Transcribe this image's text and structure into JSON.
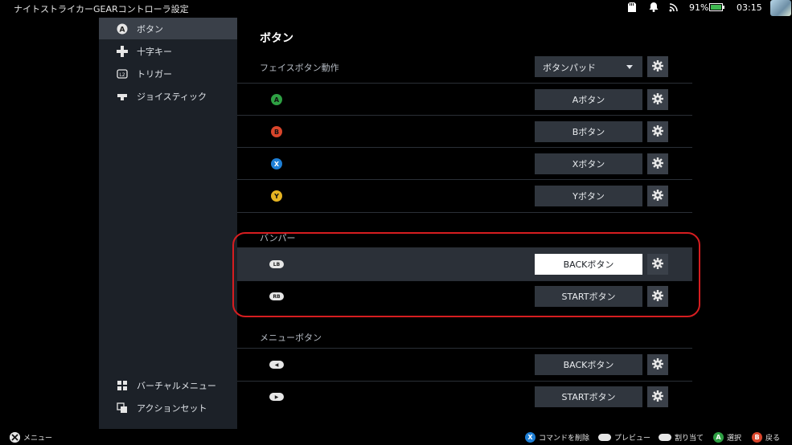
{
  "window": {
    "title": "ナイトストライカーGEARコントローラ設定"
  },
  "status_bar": {
    "battery": "91%",
    "time": "03:15"
  },
  "sidebar": {
    "items": [
      {
        "label": "ボタン",
        "icon": "a-button-icon"
      },
      {
        "label": "十字キー",
        "icon": "dpad-icon"
      },
      {
        "label": "トリガー",
        "icon": "l2-trigger-icon"
      },
      {
        "label": "ジョイスティック",
        "icon": "joystick-icon"
      }
    ],
    "bottom_items": [
      {
        "label": "バーチャルメニュー",
        "icon": "grid-icon"
      },
      {
        "label": "アクションセット",
        "icon": "layers-icon"
      }
    ]
  },
  "main": {
    "title": "ボタン",
    "face_buttons": {
      "label": "フェイスボタン動作",
      "mode": "ボタンパッド",
      "rows": [
        {
          "button": "A",
          "color": "#2ea043",
          "binding": "Aボタン"
        },
        {
          "button": "B",
          "color": "#d9452b",
          "binding": "Bボタン"
        },
        {
          "button": "X",
          "color": "#1e7fd6",
          "binding": "Xボタン"
        },
        {
          "button": "Y",
          "color": "#e6b422",
          "binding": "Yボタン"
        }
      ]
    },
    "bumpers": {
      "label": "バンパー",
      "rows": [
        {
          "button": "LB",
          "binding": "BACKボタン"
        },
        {
          "button": "RB",
          "binding": "STARTボタン"
        }
      ]
    },
    "menu_buttons": {
      "label": "メニューボタン",
      "rows": [
        {
          "button": "◀",
          "binding": "BACKボタン"
        },
        {
          "button": "▶",
          "binding": "STARTボタン"
        }
      ]
    }
  },
  "footer": {
    "menu": "メニュー",
    "hints": [
      {
        "badge": "X",
        "color": "#1e7fd6",
        "label": "コマンドを削除"
      },
      {
        "badge": "view",
        "label": "プレビュー"
      },
      {
        "badge": "menu",
        "label": "割り当て"
      },
      {
        "badge": "A",
        "color": "#2ea043",
        "label": "選択"
      },
      {
        "badge": "B",
        "color": "#d9452b",
        "label": "戻る"
      }
    ]
  },
  "colors": {
    "highlight_outline": "#d61d20",
    "sidebar_bg": "#1c2128"
  }
}
